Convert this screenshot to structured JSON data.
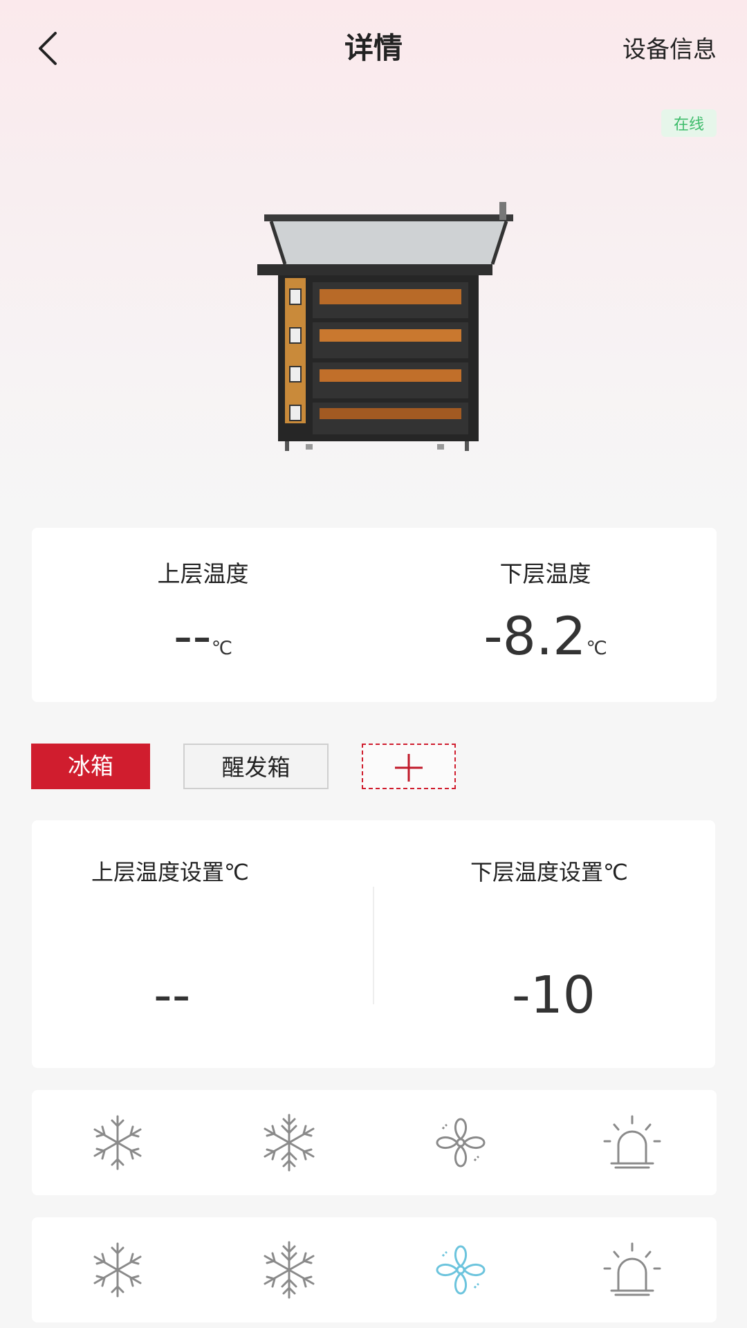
{
  "header": {
    "title": "详情",
    "right_link": "设备信息",
    "status_badge": "在线"
  },
  "temperatures": {
    "upper": {
      "label": "上层温度",
      "value": "--",
      "unit": "℃"
    },
    "lower": {
      "label": "下层温度",
      "value": "-8.2",
      "unit": "℃"
    }
  },
  "tabs": [
    {
      "label": "冰箱",
      "active": true
    },
    {
      "label": "醒发箱",
      "active": false
    },
    {
      "label": "+",
      "icon": "plus-icon"
    }
  ],
  "settings": {
    "upper": {
      "label": "上层温度设置℃",
      "value": "--"
    },
    "lower": {
      "label": "下层温度设置℃",
      "value": "-10"
    }
  },
  "function_rows": [
    {
      "icons": [
        {
          "name": "snowflake-icon",
          "active": false
        },
        {
          "name": "defrost-snowflake-icon",
          "active": false
        },
        {
          "name": "fan-icon",
          "active": false
        },
        {
          "name": "alarm-light-icon",
          "active": false
        }
      ]
    },
    {
      "icons": [
        {
          "name": "snowflake-icon",
          "active": false
        },
        {
          "name": "defrost-snowflake-icon",
          "active": false
        },
        {
          "name": "fan-icon",
          "active": true
        },
        {
          "name": "alarm-light-icon",
          "active": false
        }
      ]
    }
  ],
  "colors": {
    "accent_red": "#d01d2e",
    "online_green": "#3ebc6b",
    "icon_inactive": "#8a8a8a",
    "icon_active": "#6cc4dd"
  }
}
